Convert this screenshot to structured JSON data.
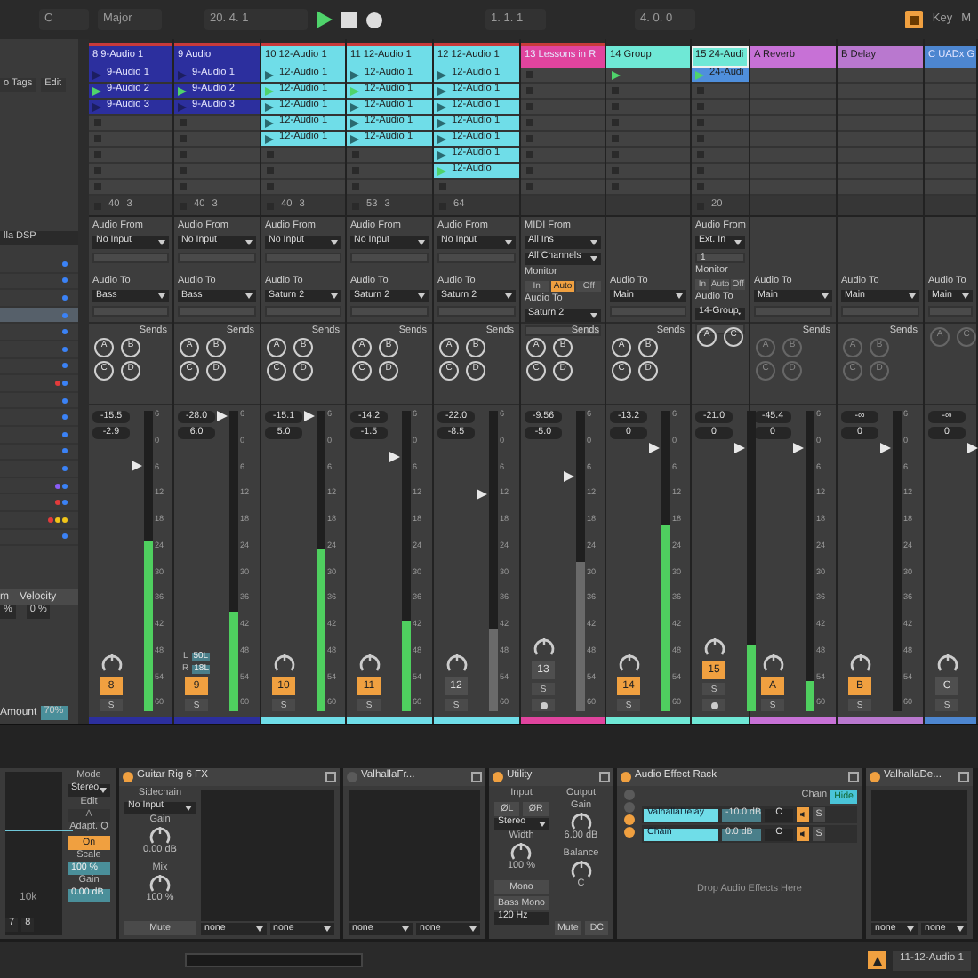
{
  "transport": {
    "key": "C",
    "scale": "Major",
    "position": "20. 4. 1",
    "playing": true,
    "loop_start": "1. 1. 1",
    "loop_length": "4. 0. 0",
    "key_label": "Key",
    "midi_label": "M"
  },
  "browser": {
    "tags": "o Tags",
    "edit": "Edit",
    "plugin": "lla DSP",
    "dot_rows": [
      {
        "selected": false,
        "dots": [
          {
            "color": "#3b82f6"
          }
        ]
      },
      {
        "selected": false,
        "dots": [
          {
            "color": "#3b82f6"
          }
        ]
      },
      {
        "selected": false,
        "dots": [
          {
            "color": "#3b82f6"
          }
        ]
      },
      {
        "selected": true,
        "dots": [
          {
            "color": "#3b82f6"
          }
        ]
      },
      {
        "selected": false,
        "dots": [
          {
            "color": "#3b82f6"
          }
        ]
      },
      {
        "selected": false,
        "dots": [
          {
            "color": "#3b82f6"
          }
        ]
      },
      {
        "selected": false,
        "dots": [
          {
            "color": "#3b82f6"
          }
        ]
      },
      {
        "selected": false,
        "dots": [
          {
            "color": "#e23b3b"
          },
          {
            "color": "#3b82f6"
          }
        ]
      },
      {
        "selected": false,
        "dots": [
          {
            "color": "#3b82f6"
          }
        ]
      },
      {
        "selected": false,
        "dots": [
          {
            "color": "#3b82f6"
          }
        ]
      },
      {
        "selected": false,
        "dots": [
          {
            "color": "#3b82f6"
          }
        ]
      },
      {
        "selected": false,
        "dots": [
          {
            "color": "#3b82f6"
          }
        ]
      },
      {
        "selected": false,
        "dots": [
          {
            "color": "#3b82f6"
          }
        ]
      },
      {
        "selected": false,
        "dots": [
          {
            "color": "#8b5cf6"
          },
          {
            "color": "#3b82f6"
          }
        ]
      },
      {
        "selected": false,
        "dots": [
          {
            "color": "#e23b3b"
          },
          {
            "color": "#3b82f6"
          }
        ]
      },
      {
        "selected": false,
        "dots": [
          {
            "color": "#e23b3b"
          },
          {
            "color": "#f0c419"
          },
          {
            "color": "#f0c419"
          }
        ]
      },
      {
        "selected": false,
        "dots": [
          {
            "color": "#3b82f6"
          }
        ]
      }
    ],
    "column_1": "m",
    "column_2": "Velocity",
    "value_1": "%",
    "value_2": "0 %",
    "amount_label": "Amount",
    "amount": "70%"
  },
  "tracks": [
    {
      "title": "8 9-Audio 1",
      "color": "#2c2f9e",
      "selected": false,
      "slots": [
        {
          "kind": "clip",
          "name": "9-Audio 1",
          "color": "#2c2f9e",
          "playing": false
        },
        {
          "kind": "clip",
          "name": "9-Audio 2",
          "color": "#2c2f9e",
          "playing": true
        },
        {
          "kind": "clip",
          "name": "9-Audio 3",
          "color": "#2c2f9e",
          "playing": false
        },
        {
          "kind": "empty"
        },
        {
          "kind": "empty"
        },
        {
          "kind": "empty"
        },
        {
          "kind": "empty"
        },
        {
          "kind": "empty"
        }
      ],
      "status": [
        "40",
        "3"
      ],
      "input": [
        {
          "kind": "label",
          "text": "Audio From"
        },
        {
          "kind": "select",
          "text": "No Input"
        },
        {
          "kind": "field"
        }
      ],
      "output": [
        {
          "kind": "label",
          "text": "Audio To"
        },
        {
          "kind": "select",
          "text": "Bass"
        },
        {
          "kind": "field"
        }
      ],
      "sends_label": "Sends",
      "sends": [
        "A",
        "B",
        "C",
        "D"
      ],
      "sends_enabled": true,
      "volume": "-15.5",
      "pan": "-2.9",
      "fader": {
        "level": 0.83
      },
      "meter": {
        "level": 0.57
      },
      "scale": [
        "6",
        "0",
        "6",
        "12",
        "18",
        "24",
        "30",
        "36",
        "42",
        "48",
        "54",
        "60"
      ],
      "number": "8",
      "active": true,
      "solo": "S",
      "arm": false
    },
    {
      "title": "9 Audio",
      "color": "#2c2f9e",
      "selected": false,
      "slots": [
        {
          "kind": "clip",
          "name": "9-Audio 1",
          "color": "#2c2f9e",
          "playing": false
        },
        {
          "kind": "clip",
          "name": "9-Audio 2",
          "color": "#2c2f9e",
          "playing": true
        },
        {
          "kind": "clip",
          "name": "9-Audio 3",
          "color": "#2c2f9e",
          "playing": false
        },
        {
          "kind": "empty"
        },
        {
          "kind": "empty"
        },
        {
          "kind": "empty"
        },
        {
          "kind": "empty"
        },
        {
          "kind": "empty"
        }
      ],
      "status": [
        "40",
        "3"
      ],
      "input": [
        {
          "kind": "label",
          "text": "Audio From"
        },
        {
          "kind": "select",
          "text": "No Input"
        },
        {
          "kind": "field"
        }
      ],
      "output": [
        {
          "kind": "label",
          "text": "Audio To"
        },
        {
          "kind": "select",
          "text": "Bass"
        },
        {
          "kind": "field"
        }
      ],
      "sends_label": "Sends",
      "sends": [
        "A",
        "B",
        "C",
        "D"
      ],
      "sends_enabled": true,
      "volume": "-28.0",
      "pan": "6.0",
      "split_pan": [
        {
          "label": "L",
          "value": "50L"
        },
        {
          "label": "R",
          "value": "18L"
        }
      ],
      "fader": {
        "level": 1
      },
      "meter": {
        "level": 0.33
      },
      "scale": [
        "6",
        "0",
        "6",
        "12",
        "18",
        "24",
        "30",
        "36",
        "42",
        "48",
        "54",
        "60"
      ],
      "number": "9",
      "active": true,
      "solo": "S",
      "arm": false
    },
    {
      "title": "10 12-Audio 1",
      "color": "#6fdde8",
      "selected": false,
      "slots": [
        {
          "kind": "clip",
          "name": "12-Audio 1",
          "color": "#6fdde8",
          "playing": false
        },
        {
          "kind": "clip",
          "name": "12-Audio 1",
          "color": "#6fdde8",
          "playing": true
        },
        {
          "kind": "clip",
          "name": "12-Audio 1",
          "color": "#6fdde8",
          "playing": false
        },
        {
          "kind": "clip",
          "name": "12-Audio 1",
          "color": "#6fdde8",
          "playing": false
        },
        {
          "kind": "clip",
          "name": "12-Audio 1",
          "color": "#6fdde8",
          "playing": false
        },
        {
          "kind": "empty"
        },
        {
          "kind": "empty"
        },
        {
          "kind": "empty"
        }
      ],
      "status": [
        "40",
        "3"
      ],
      "input": [
        {
          "kind": "label",
          "text": "Audio From"
        },
        {
          "kind": "select",
          "text": "No Input"
        },
        {
          "kind": "field"
        }
      ],
      "output": [
        {
          "kind": "label",
          "text": "Audio To"
        },
        {
          "kind": "select",
          "text": "Saturn 2"
        },
        {
          "kind": "field"
        }
      ],
      "sends_label": "Sends",
      "sends": [
        "A",
        "B",
        "C",
        "D"
      ],
      "sends_enabled": true,
      "volume": "-15.1",
      "pan": "5.0",
      "fader": {
        "level": 1
      },
      "meter": {
        "level": 0.54
      },
      "scale": [
        "6",
        "0",
        "6",
        "12",
        "18",
        "24",
        "30",
        "36",
        "42",
        "48",
        "54",
        "60"
      ],
      "number": "10",
      "active": true,
      "solo": "S",
      "arm": false
    },
    {
      "title": "11 12-Audio 1",
      "color": "#6fdde8",
      "selected": false,
      "slots": [
        {
          "kind": "clip",
          "name": "12-Audio 1",
          "color": "#6fdde8",
          "playing": false
        },
        {
          "kind": "clip",
          "name": "12-Audio 1",
          "color": "#6fdde8",
          "playing": true
        },
        {
          "kind": "clip",
          "name": "12-Audio 1",
          "color": "#6fdde8",
          "playing": false
        },
        {
          "kind": "clip",
          "name": "12-Audio 1",
          "color": "#6fdde8",
          "playing": false
        },
        {
          "kind": "clip",
          "name": "12-Audio 1",
          "color": "#6fdde8",
          "playing": false
        },
        {
          "kind": "empty"
        },
        {
          "kind": "empty"
        },
        {
          "kind": "empty"
        }
      ],
      "status": [
        "53",
        "3"
      ],
      "input": [
        {
          "kind": "label",
          "text": "Audio From"
        },
        {
          "kind": "select",
          "text": "No Input"
        },
        {
          "kind": "field"
        }
      ],
      "output": [
        {
          "kind": "label",
          "text": "Audio To"
        },
        {
          "kind": "select",
          "text": "Saturn 2"
        },
        {
          "kind": "field"
        }
      ],
      "sends_label": "Sends",
      "sends": [
        "A",
        "B",
        "C",
        "D"
      ],
      "sends_enabled": true,
      "volume": "-14.2",
      "pan": "-1.5",
      "fader": {
        "level": 0.86
      },
      "meter": {
        "level": 0.3
      },
      "scale": [
        "6",
        "0",
        "6",
        "12",
        "18",
        "24",
        "30",
        "36",
        "42",
        "48",
        "54",
        "60"
      ],
      "number": "11",
      "active": true,
      "solo": "S",
      "arm": false
    },
    {
      "title": "12 12-Audio 1",
      "color": "#6fdde8",
      "selected": false,
      "slots": [
        {
          "kind": "clip",
          "name": "12-Audio 1",
          "color": "#6fdde8",
          "playing": false
        },
        {
          "kind": "clip",
          "name": "12-Audio 1",
          "color": "#6fdde8",
          "playing": false
        },
        {
          "kind": "clip",
          "name": "12-Audio 1",
          "color": "#6fdde8",
          "playing": false
        },
        {
          "kind": "clip",
          "name": "12-Audio 1",
          "color": "#6fdde8",
          "playing": false
        },
        {
          "kind": "clip",
          "name": "12-Audio 1",
          "color": "#6fdde8",
          "playing": false
        },
        {
          "kind": "clip",
          "name": "12-Audio 1",
          "color": "#6fdde8",
          "playing": false
        },
        {
          "kind": "clip",
          "name": "12-Audio",
          "color": "#6fdde8",
          "playing": true
        },
        {
          "kind": "empty"
        }
      ],
      "status": [
        "64"
      ],
      "input": [
        {
          "kind": "label",
          "text": "Audio From"
        },
        {
          "kind": "select",
          "text": "No Input"
        },
        {
          "kind": "field"
        }
      ],
      "output": [
        {
          "kind": "label",
          "text": "Audio To"
        },
        {
          "kind": "select",
          "text": "Saturn 2"
        },
        {
          "kind": "field"
        }
      ],
      "sends_label": "Sends",
      "sends": [
        "A",
        "B",
        "C",
        "D"
      ],
      "sends_enabled": true,
      "volume": "-22.0",
      "pan": "-8.5",
      "fader": {
        "level": 0.73
      },
      "meter": {
        "level": 0.27
      },
      "scale": [
        "6",
        "0",
        "6",
        "12",
        "18",
        "24",
        "30",
        "36",
        "42",
        "48",
        "54",
        "60"
      ],
      "number": "12",
      "active": false,
      "solo": "S",
      "arm": false
    },
    {
      "title": "13 Lessons in R",
      "color": "#e0449e",
      "selected": false,
      "slots": [
        {
          "kind": "empty"
        },
        {
          "kind": "empty"
        },
        {
          "kind": "empty"
        },
        {
          "kind": "empty"
        },
        {
          "kind": "empty"
        },
        {
          "kind": "empty"
        },
        {
          "kind": "empty"
        },
        {
          "kind": "empty"
        }
      ],
      "input": [
        {
          "kind": "label",
          "text": "MIDI From"
        },
        {
          "kind": "select",
          "text": "All Ins"
        },
        {
          "kind": "select",
          "text": "All Channels"
        },
        {
          "kind": "label",
          "text": "Monitor"
        },
        {
          "kind": "monitor",
          "options": [
            {
              "label": "In",
              "selected": false
            },
            {
              "label": "Auto",
              "selected": true
            },
            {
              "label": "Off",
              "selected": false
            }
          ]
        }
      ],
      "output": [
        {
          "kind": "label",
          "text": "Audio To"
        },
        {
          "kind": "select",
          "text": "Saturn 2"
        },
        {
          "kind": "field"
        }
      ],
      "sends_label": "Sends",
      "sends": [
        "A",
        "B",
        "C",
        "D"
      ],
      "sends_enabled": true,
      "volume": "-9.56",
      "pan": "-5.0",
      "fader": {
        "level": 0.79
      },
      "meter": {
        "level": 0.5
      },
      "scale": [
        "6",
        "0",
        "6",
        "12",
        "18",
        "24",
        "30",
        "36",
        "42",
        "48",
        "54",
        "60"
      ],
      "number": "13",
      "active": false,
      "solo": "S",
      "arm": true
    },
    {
      "title": "14 Group",
      "color": "#6fe8d6",
      "selected": false,
      "slots": [
        {
          "kind": "group"
        },
        {
          "kind": "empty"
        },
        {
          "kind": "empty"
        },
        {
          "kind": "empty"
        },
        {
          "kind": "empty"
        },
        {
          "kind": "empty"
        },
        {
          "kind": "empty"
        },
        {
          "kind": "empty"
        }
      ],
      "output": [
        {
          "kind": "label",
          "text": "Audio To"
        },
        {
          "kind": "select",
          "text": "Main"
        },
        {
          "kind": "field"
        }
      ],
      "sends_label": "Sends",
      "sends": [
        "A",
        "B",
        "C",
        "D"
      ],
      "sends_enabled": true,
      "volume": "-13.2",
      "pan": "0",
      "fader": {
        "level": 0.89
      },
      "meter": {
        "level": 0.62
      },
      "scale": [
        "6",
        "0",
        "6",
        "12",
        "18",
        "24",
        "30",
        "36",
        "42",
        "48",
        "54",
        "60"
      ],
      "number": "14",
      "active": true,
      "solo": "S",
      "arm": false
    },
    {
      "title": "15 24-Audi",
      "color": "#6fe8d6",
      "selected": true,
      "slots": [
        {
          "kind": "clip",
          "name": "24-Audi",
          "color": "#4f8fdc",
          "playing": true
        },
        {
          "kind": "empty"
        },
        {
          "kind": "empty"
        },
        {
          "kind": "empty"
        },
        {
          "kind": "empty"
        },
        {
          "kind": "empty"
        },
        {
          "kind": "empty"
        },
        {
          "kind": "empty"
        }
      ],
      "status": [
        "20"
      ],
      "input": [
        {
          "kind": "label",
          "text": "Audio From"
        },
        {
          "kind": "select",
          "text": "Ext. In"
        },
        {
          "kind": "field",
          "text": "1"
        },
        {
          "kind": "label",
          "text": "Monitor"
        },
        {
          "kind": "monitor",
          "options": [
            {
              "label": "In",
              "selected": false
            },
            {
              "label": "Auto",
              "selected": false
            },
            {
              "label": "Off",
              "selected": false
            }
          ]
        }
      ],
      "output": [
        {
          "kind": "label",
          "text": "Audio To"
        },
        {
          "kind": "select",
          "text": "14-Group"
        },
        {
          "kind": "field"
        }
      ],
      "sends": [
        "A",
        "C"
      ],
      "sends_enabled": true,
      "volume": "-21.0",
      "pan": "0",
      "fader": {
        "level": 0.89
      },
      "meter": {
        "level": 0.22
      },
      "number": "15",
      "active": true,
      "solo": "S",
      "arm": true
    },
    {
      "title": "A Reverb",
      "color": "#c771d6",
      "selected": false,
      "slots": [
        {
          "kind": "blank"
        },
        {
          "kind": "blank"
        },
        {
          "kind": "blank"
        },
        {
          "kind": "blank"
        },
        {
          "kind": "blank"
        },
        {
          "kind": "blank"
        },
        {
          "kind": "blank"
        },
        {
          "kind": "blank"
        }
      ],
      "output": [
        {
          "kind": "label",
          "text": "Audio To"
        },
        {
          "kind": "select",
          "text": "Main"
        },
        {
          "kind": "field"
        }
      ],
      "sends_label": "Sends",
      "sends": [
        "A",
        "B",
        "C",
        "D"
      ],
      "sends_enabled": false,
      "volume": "-45.4",
      "pan": "0",
      "fader": {
        "level": 0.89
      },
      "meter": {
        "level": 0.1
      },
      "scale": [
        "6",
        "0",
        "6",
        "12",
        "18",
        "24",
        "30",
        "36",
        "42",
        "48",
        "54",
        "60"
      ],
      "number": "A",
      "active": true,
      "solo": "S",
      "arm": false
    },
    {
      "title": "B Delay",
      "color": "#b978cf",
      "selected": false,
      "slots": [
        {
          "kind": "blank"
        },
        {
          "kind": "blank"
        },
        {
          "kind": "blank"
        },
        {
          "kind": "blank"
        },
        {
          "kind": "blank"
        },
        {
          "kind": "blank"
        },
        {
          "kind": "blank"
        },
        {
          "kind": "blank"
        }
      ],
      "output": [
        {
          "kind": "label",
          "text": "Audio To"
        },
        {
          "kind": "select",
          "text": "Main"
        },
        {
          "kind": "field"
        }
      ],
      "sends_label": "Sends",
      "sends": [
        "A",
        "B",
        "C",
        "D"
      ],
      "sends_enabled": false,
      "volume": "-∞",
      "pan": "0",
      "fader": {
        "level": 0.89
      },
      "scale": [
        "6",
        "0",
        "6",
        "12",
        "18",
        "24",
        "30",
        "36",
        "42",
        "48",
        "54",
        "60"
      ],
      "number": "B",
      "active": true,
      "solo": "S",
      "arm": false
    },
    {
      "title": "C UADx G",
      "color": "#4d86d0",
      "selected": false,
      "slots": [
        {
          "kind": "blank"
        },
        {
          "kind": "blank"
        },
        {
          "kind": "blank"
        },
        {
          "kind": "blank"
        },
        {
          "kind": "blank"
        },
        {
          "kind": "blank"
        },
        {
          "kind": "blank"
        },
        {
          "kind": "blank"
        }
      ],
      "output": [
        {
          "kind": "label",
          "text": "Audio To"
        },
        {
          "kind": "select",
          "text": "Main"
        },
        {
          "kind": "field"
        }
      ],
      "sends": [
        "A",
        "C"
      ],
      "sends_enabled": false,
      "volume": "-∞",
      "pan": "0",
      "fader": {
        "level": 0.89
      },
      "number": "C",
      "active": false,
      "solo": "S",
      "arm": false
    }
  ],
  "devices": [
    {
      "kind": "eq",
      "freq_label": "10k",
      "band_labels": [
        "7",
        "8"
      ],
      "params": [
        {
          "label": "Mode",
          "kind": "select",
          "value": "Stereo"
        },
        {
          "label": "Edit",
          "kind": "plain",
          "value": "A"
        },
        {
          "label": "Adapt. Q",
          "kind": "toggle",
          "value": "On",
          "on": true
        },
        {
          "label": "Scale",
          "kind": "number",
          "value": "100 %"
        },
        {
          "label": "Gain",
          "kind": "number",
          "value": "0.00 dB"
        }
      ]
    },
    {
      "kind": "plugin",
      "title": "Guitar Rig 6 FX",
      "on": true,
      "sidechain": {
        "label": "Sidechain",
        "value": "No Input"
      },
      "knobs": [
        {
          "label": "Gain",
          "value": "0.00 dB"
        },
        {
          "label": "Mix",
          "value": "100 %"
        }
      ],
      "mute": "Mute",
      "selectors": [
        "none",
        "none"
      ]
    },
    {
      "kind": "plugin",
      "title": "ValhallaFr...",
      "on": false,
      "selectors": [
        "none",
        "none"
      ]
    },
    {
      "kind": "utility",
      "title": "Utility",
      "on": true,
      "input_label": "Input",
      "phase": [
        "ØL",
        "ØR"
      ],
      "channel": "Stereo",
      "width": {
        "label": "Width",
        "value": "100 %"
      },
      "mono": "Mono",
      "bass_mono": "Bass Mono",
      "bass_freq": "120 Hz",
      "output_label": "Output",
      "gain": {
        "label": "Gain",
        "value": "6.00 dB"
      },
      "balance": {
        "label": "Balance",
        "value": "C"
      },
      "mute": "Mute",
      "dc": "DC"
    },
    {
      "kind": "rack",
      "title": "Audio Effect Rack",
      "on": true,
      "chain_label": "Chain",
      "hide": "Hide",
      "chains": [
        {
          "name": "ValhallaDelay",
          "volume": "-10.0 dB",
          "pan": "C",
          "solo": "S"
        },
        {
          "name": "Chain",
          "volume": "0.0 dB",
          "pan": "C",
          "solo": "S"
        }
      ],
      "drop_hint": "Drop Audio Effects Here"
    },
    {
      "kind": "plugin",
      "title": "ValhallaDe...",
      "on": true,
      "selectors": [
        "none",
        "none"
      ]
    }
  ],
  "status_bar": {
    "clip": "11-12-Audio 1"
  }
}
